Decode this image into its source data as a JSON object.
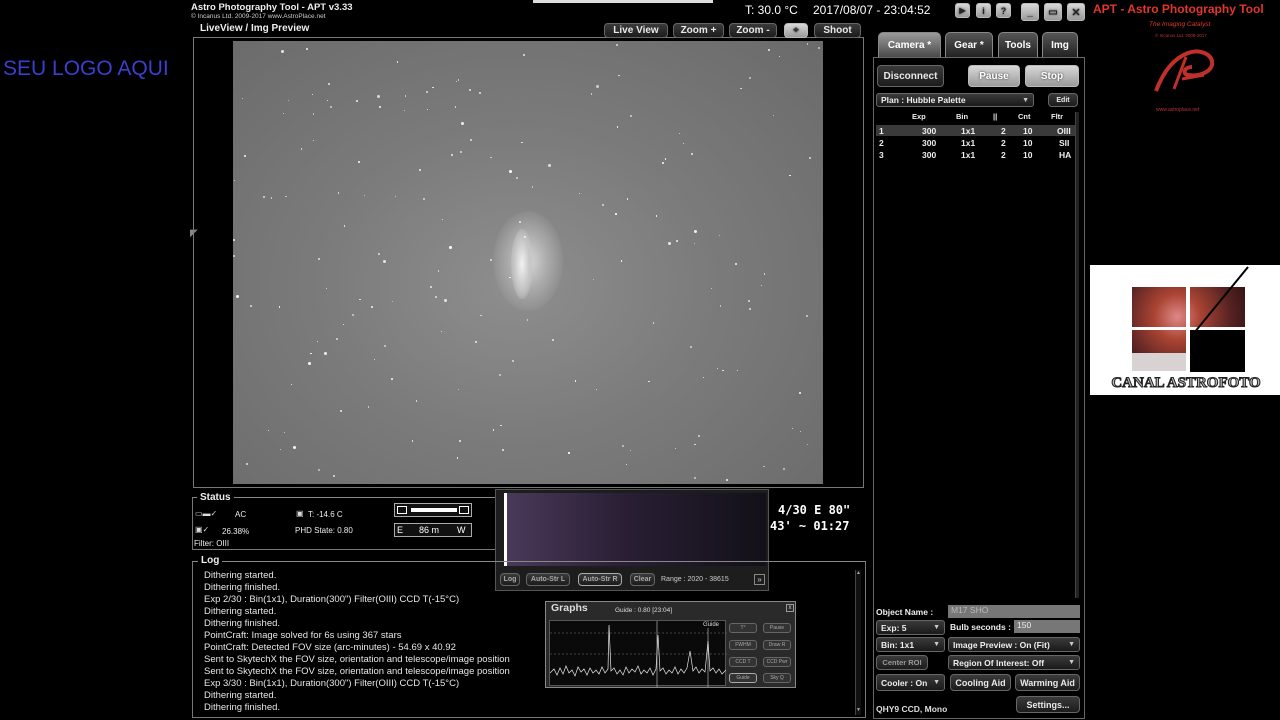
{
  "app": {
    "title_line1": "Astro Photography Tool  -  APT v3.33",
    "title_line2": "© Incanus Ltd. 2009-2017  www.AstroPlace.net",
    "temperature": "T: 30.0 °C",
    "datetime": "2017/08/07 - 23:04:52",
    "brand_title": "APT - Astro Photography Tool",
    "brand_sub1": "The Imaging Catalyst",
    "brand_sub2": "© Incanus Ltd. 2009-2017",
    "brand_url": "www.astroplace.net"
  },
  "overlay": {
    "logo_text": "SEU LOGO AQUI",
    "channel_name": "CANAL ASTROFOTO"
  },
  "preview": {
    "title": "LiveView / Img Preview",
    "live_view": "Live View",
    "zoom_in": "Zoom +",
    "zoom_out": "Zoom -",
    "shoot": "Shoot"
  },
  "tabs": [
    "Camera *",
    "Gear *",
    "Tools",
    "Img"
  ],
  "camera": {
    "disconnect": "Disconnect",
    "pause": "Pause",
    "stop": "Stop",
    "plan": "Plan : Hubble Palette",
    "edit": "Edit",
    "headers": [
      "Exp",
      "Bin",
      "||",
      "Cnt",
      "Fltr"
    ],
    "rows": [
      {
        "n": "1",
        "exp": "300",
        "bin": "1x1",
        "p": "2",
        "cnt": "10",
        "fltr": "OIII"
      },
      {
        "n": "2",
        "exp": "300",
        "bin": "1x1",
        "p": "2",
        "cnt": "10",
        "fltr": "SII"
      },
      {
        "n": "3",
        "exp": "300",
        "bin": "1x1",
        "p": "2",
        "cnt": "10",
        "fltr": "HA"
      }
    ],
    "object_label": "Object Name :",
    "object_value": "M17 SHO",
    "exp": "Exp: 5",
    "bulb_label": "Bulb seconds :",
    "bulb_value": "150",
    "bin": "Bin: 1x1",
    "image_preview": "Image Preview : On (Fit)",
    "center_roi": "Center ROI",
    "roi": "Region Of Interest: Off",
    "cooler": "Cooler : On",
    "cooling_aid": "Cooling Aid",
    "warming_aid": "Warming Aid",
    "camera_name": "QHY9 CCD, Mono",
    "settings": "Settings..."
  },
  "status": {
    "title": "Status",
    "power": "AC",
    "battery": "26.38%",
    "filter": "Filter: OIII",
    "ccd_temp": "T:  -14.6 C",
    "phd_state": "PHD State: 0.80",
    "e_label": "E",
    "meridian": "86 m",
    "w_label": "W",
    "coords_line1": "4/30 E  80\"",
    "coords_line2": "43'  ~  01:27"
  },
  "histogram": {
    "log": "Log",
    "auto_str_l": "Auto-Str L",
    "auto_str_r": "Auto-Str R",
    "clear": "Clear",
    "range": "Range : 2020 - 38615"
  },
  "graphs": {
    "title": "Graphs",
    "info": "Guide : 0.80 [23:04]",
    "legend": "Guide",
    "buttons": [
      "T°",
      "Pause",
      "FWHM",
      "Draw R",
      "CCD T",
      "CCD Pwr",
      "Guide",
      "Sky Q"
    ]
  },
  "log": {
    "title": "Log",
    "lines": [
      "Dithering started.",
      "Dithering finished.",
      "Exp 2/30 : Bin(1x1), Duration(300\") Filter(OIII) CCD T(-15°C)",
      "Dithering started.",
      "Dithering finished.",
      "PointCraft: Image solved for 6s using 367 stars",
      "PointCraft: Detected FOV size (arc-minutes) - 54.69 x 40.92",
      "Sent to SkytechX the FOV size, orientation and telescope/image position",
      "Sent to SkytechX the FOV size, orientation and telescope/image position",
      "Exp 3/30 : Bin(1x1), Duration(300\") Filter(OIII) CCD T(-15°C)",
      "Dithering started.",
      "Dithering finished."
    ]
  },
  "colors": {
    "brand_red": "#e0362c",
    "logo_blue": "#3a3fcf"
  }
}
